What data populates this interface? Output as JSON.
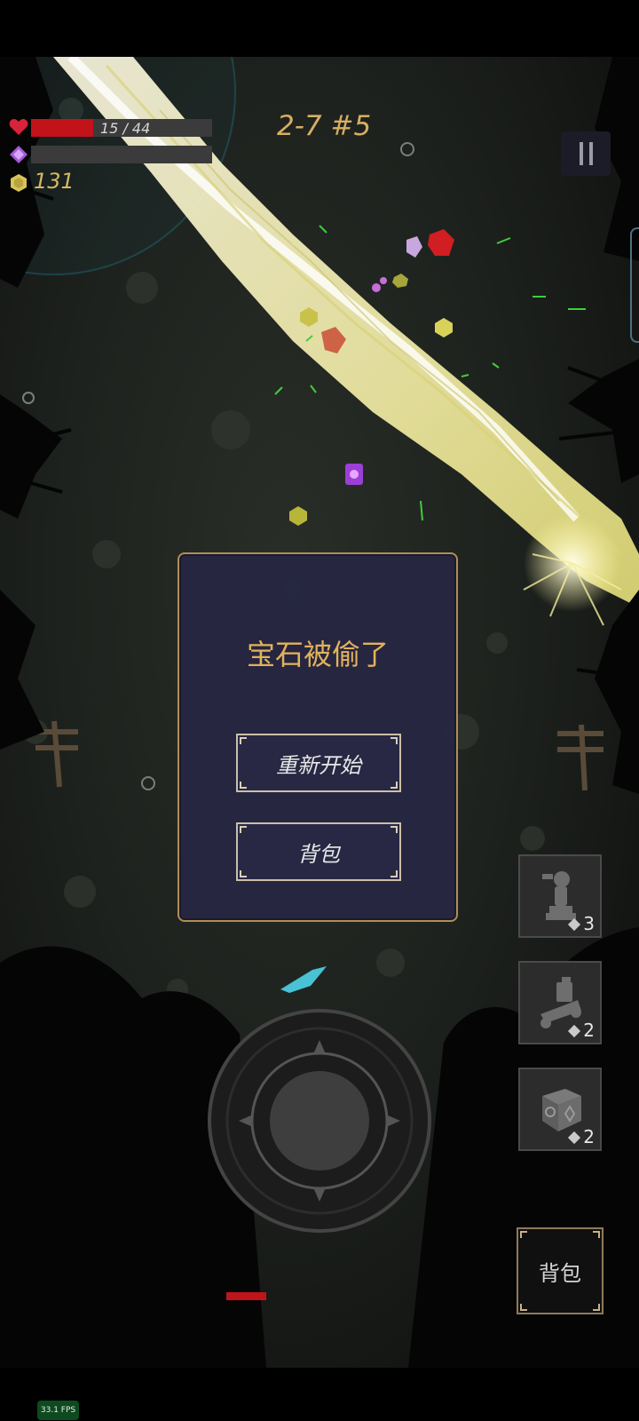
{
  "hud": {
    "hp_text": "15 / 44",
    "hp_fraction": 0.3409,
    "mana_fraction": 0,
    "coins": "131",
    "level": "2-7 #5"
  },
  "dialog": {
    "title": "宝石被偷了",
    "restart_label": "重新开始",
    "bag_label": "背包"
  },
  "slots": [
    {
      "icon": "turret-statue-icon",
      "count": "3"
    },
    {
      "icon": "siege-cart-icon",
      "count": "2"
    },
    {
      "icon": "rune-cube-icon",
      "count": "2"
    }
  ],
  "bag_button": {
    "label": "背包"
  },
  "fps": "33.1 FPS",
  "colors": {
    "hp": "#c2121a",
    "gold": "#d6ae63",
    "dialog_bg": "#262642",
    "dialog_border": "#b08d58",
    "beam": "#fff6a8"
  }
}
